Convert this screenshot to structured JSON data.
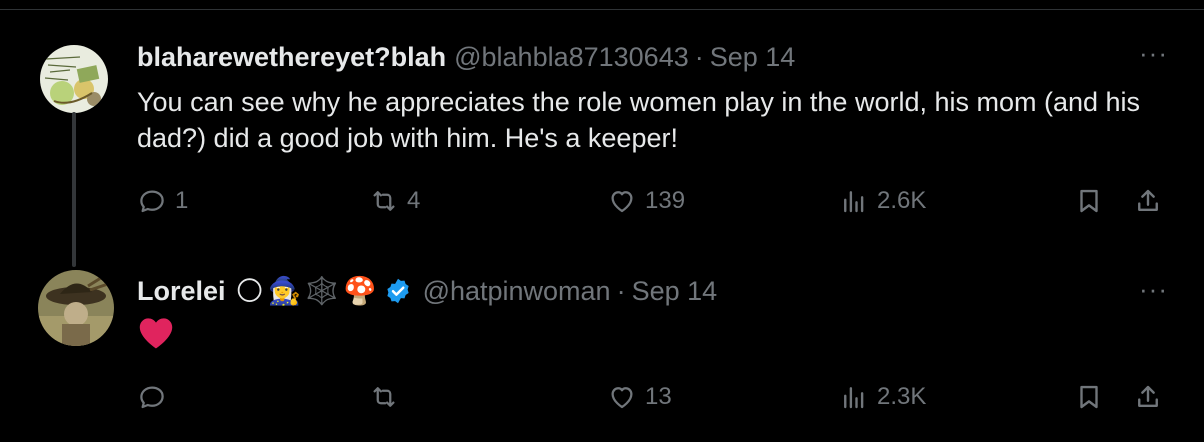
{
  "tweets": [
    {
      "display_name": "blaharewethereyet?blah",
      "handle": "@blahbla87130643",
      "separator": "·",
      "date": "Sep 14",
      "more_label": "···",
      "text": "You can see why he appreciates the role women play in the world, his mom (and his dad?) did a good job with him.  He's a keeper!",
      "counts": {
        "replies": "1",
        "reposts": "4",
        "likes": "139",
        "views": "2.6K"
      }
    },
    {
      "display_name": "Lorelei",
      "name_emojis": [
        "🌕",
        "🧙‍♀️",
        "🕸️",
        "🍄"
      ],
      "verified": true,
      "handle": "@hatpinwoman",
      "separator": "·",
      "date": "Sep 14",
      "more_label": "···",
      "text": "❤️",
      "counts": {
        "replies": "",
        "reposts": "",
        "likes": "13",
        "views": "2.3K"
      }
    }
  ],
  "colors": {
    "background": "#000000",
    "text": "#e7e9ea",
    "muted": "#71767b",
    "verified": "#1d9bf0",
    "heart": "#f91880"
  },
  "icons": [
    "reply-icon",
    "repost-icon",
    "like-icon",
    "views-icon",
    "bookmark-icon",
    "share-icon",
    "more-icon",
    "verified-badge-icon"
  ]
}
